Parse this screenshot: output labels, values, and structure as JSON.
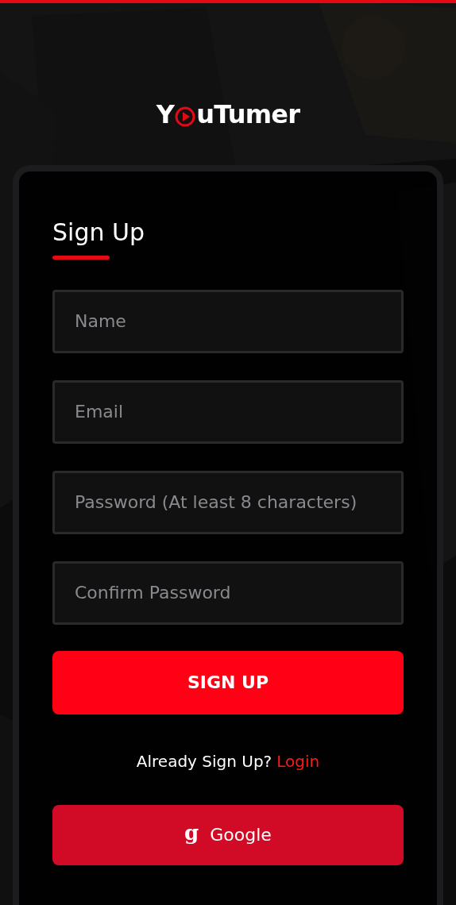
{
  "logo": {
    "before": "Y",
    "after": "uTumer"
  },
  "form": {
    "title": "Sign Up",
    "fields": [
      {
        "placeholder": "Name"
      },
      {
        "placeholder": "Email"
      },
      {
        "placeholder": "Password (At least 8 characters)"
      },
      {
        "placeholder": "Confirm Password"
      }
    ],
    "submit": "SIGN UP",
    "login_prompt": "Already Sign Up?",
    "login_link": "Login",
    "google_button": {
      "icon": "g",
      "label": "Google"
    }
  }
}
